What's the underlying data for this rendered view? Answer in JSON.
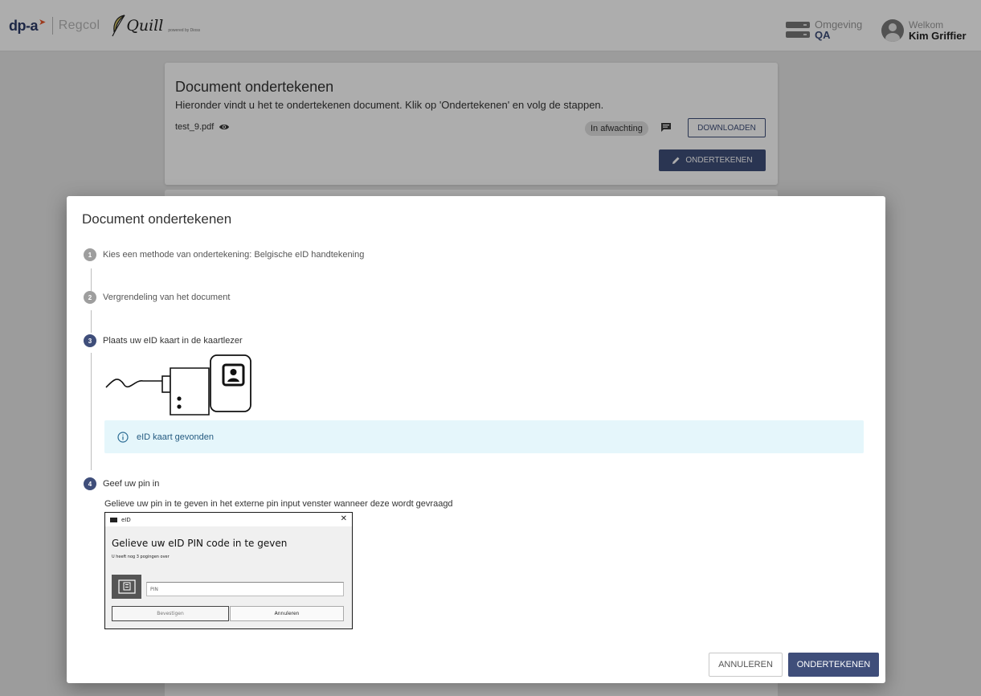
{
  "header": {
    "logo_dpa": "dp-a",
    "logo_regcol": "Regcol",
    "logo_quill": "Quill",
    "logo_powered": "powered by Dioss",
    "env_label": "Omgeving",
    "env_value": "QA",
    "welcome_label": "Welkom",
    "user_name": "Kim Griffier"
  },
  "page": {
    "card_title": "Document ondertekenen",
    "card_subtitle": "Hieronder vindt u het te ondertekenen document. Klik op 'Ondertekenen' en volg de stappen.",
    "file_name": "test_9.pdf",
    "status": "In afwachting",
    "download_label": "DOWNLOADEN",
    "sign_label": "ONDERTEKENEN"
  },
  "modal": {
    "title": "Document ondertekenen",
    "steps": [
      {
        "number": "1",
        "label": "Kies een methode van ondertekening: Belgische eID handtekening"
      },
      {
        "number": "2",
        "label": "Vergrendeling van het document"
      },
      {
        "number": "3",
        "label": "Plaats uw eID kaart in de kaartlezer"
      },
      {
        "number": "4",
        "label": "Geef uw pin in"
      }
    ],
    "info_message": "eID kaart gevonden",
    "pin_instruction": "Gelieve uw pin in te geven in het externe pin input venster wanneer deze wordt gevraagd",
    "pin_dialog": {
      "window_title": "eID",
      "close_glyph": "✕",
      "heading": "Gelieve uw eID PIN code in te geven",
      "attempts": "U heeft nog 3 pogingen over",
      "input_placeholder": "PIN",
      "confirm_label": "Bevestigen",
      "cancel_label": "Annuleren"
    },
    "cancel_label": "ANNULEREN",
    "sign_label": "ONDERTEKENEN"
  },
  "colors": {
    "primary": "#3f4e7a",
    "info_bg": "#e5f6fb",
    "accent_orange": "#e8572c"
  },
  "icons": [
    "eye-icon",
    "comment-icon",
    "pencil-icon",
    "info-icon",
    "card-reader-icon",
    "eid-card-icon",
    "server-icon",
    "account-icon",
    "quill-feather-icon"
  ]
}
